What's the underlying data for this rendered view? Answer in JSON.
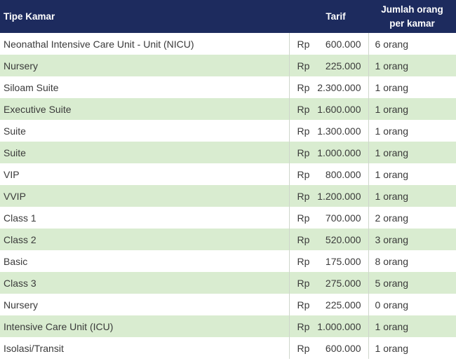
{
  "header": {
    "type": "Tipe Kamar",
    "tarif": "Tarif",
    "per_line1": "Jumlah orang",
    "per_line2": "per kamar"
  },
  "colors": {
    "header_bg": "#1d2b5e",
    "row_alt": "#d9ecd0",
    "row_base": "#ffffff"
  },
  "rows": [
    {
      "type": "Neonathal Intensive Care Unit - Unit (NICU)",
      "currency": "Rp",
      "amount": "600.000",
      "per_room": "6 orang"
    },
    {
      "type": "Nursery",
      "currency": "Rp",
      "amount": "225.000",
      "per_room": "1 orang"
    },
    {
      "type": "Siloam Suite",
      "currency": "Rp",
      "amount": "2.300.000",
      "per_room": "1 orang"
    },
    {
      "type": "Executive Suite",
      "currency": "Rp",
      "amount": "1.600.000",
      "per_room": "1 orang"
    },
    {
      "type": "Suite",
      "currency": "Rp",
      "amount": "1.300.000",
      "per_room": "1 orang"
    },
    {
      "type": "Suite",
      "currency": "Rp",
      "amount": "1.000.000",
      "per_room": "1 orang"
    },
    {
      "type": "VIP",
      "currency": "Rp",
      "amount": "800.000",
      "per_room": "1 orang"
    },
    {
      "type": "VVIP",
      "currency": "Rp",
      "amount": "1.200.000",
      "per_room": "1 orang"
    },
    {
      "type": "Class 1",
      "currency": "Rp",
      "amount": "700.000",
      "per_room": "2 orang"
    },
    {
      "type": "Class 2",
      "currency": "Rp",
      "amount": "520.000",
      "per_room": "3 orang"
    },
    {
      "type": "Basic",
      "currency": "Rp",
      "amount": "175.000",
      "per_room": "8 orang"
    },
    {
      "type": "Class 3",
      "currency": "Rp",
      "amount": "275.000",
      "per_room": "5 orang"
    },
    {
      "type": "Nursery",
      "currency": "Rp",
      "amount": "225.000",
      "per_room": "0 orang"
    },
    {
      "type": "Intensive Care Unit (ICU)",
      "currency": "Rp",
      "amount": "1.000.000",
      "per_room": "1 orang"
    },
    {
      "type": "Isolasi/Transit",
      "currency": "Rp",
      "amount": "600.000",
      "per_room": "1 orang"
    }
  ]
}
